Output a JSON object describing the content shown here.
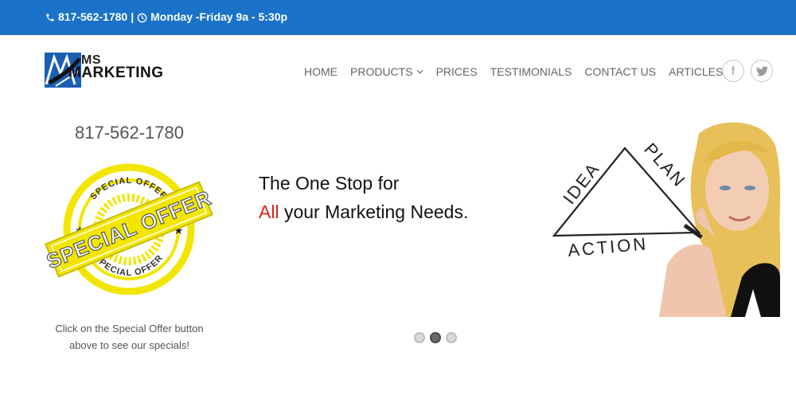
{
  "topbar": {
    "phone": "817-562-1780",
    "separator": "|",
    "hours": "Monday -Friday 9a - 5:30p"
  },
  "logo": {
    "line1": "MS",
    "line2": "MARKETING"
  },
  "nav": {
    "items": [
      {
        "label": "HOME"
      },
      {
        "label": "PRODUCTS"
      },
      {
        "label": "PRICES"
      },
      {
        "label": "TESTIMONIALS"
      },
      {
        "label": "CONTACT US"
      },
      {
        "label": "ARTICLES"
      }
    ]
  },
  "social": {
    "facebook_glyph": "f"
  },
  "sidebar": {
    "phone": "817-562-1780",
    "stamp_text_top": "SPECIAL OFFER",
    "stamp_text_main": "SPECIAL OFFER",
    "stamp_text_bottom": "SPECIAL OFFER",
    "caption": "Click on the Special Offer button above to see our specials!"
  },
  "hero": {
    "line1": "The One Stop for",
    "line2_highlight": "All",
    "line2_rest": " your Marketing Needs.",
    "diagram_idea": "IDEA",
    "diagram_plan": "PLAN",
    "diagram_action": "ACTION"
  },
  "slider": {
    "dot_count": 3,
    "active_index": 1
  },
  "colors": {
    "topbar": "#1a73c9",
    "accent_red": "#e0201b",
    "stamp_yellow": "#f2e600"
  }
}
